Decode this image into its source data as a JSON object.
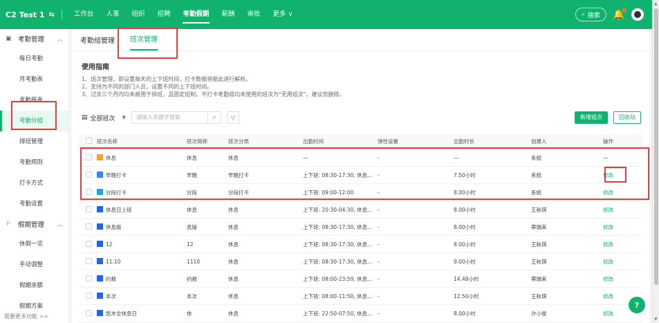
{
  "header": {
    "company": "Test 1",
    "logo_mark": "C2",
    "nav": [
      "工作台",
      "人事",
      "组织",
      "招聘",
      "考勤假期",
      "薪酬",
      "审批",
      "更多"
    ],
    "active_nav_index": 4,
    "search_label": "搜索",
    "brand_color": "#10b26e"
  },
  "sidebar": {
    "groups": [
      {
        "label": "考勤管理",
        "icon": "calendar-icon",
        "items": [
          "每日考勤",
          "月考勤表",
          "考勤报表",
          "考勤分组",
          "排班管理",
          "考勤规则",
          "打卡方式",
          "考勤设置"
        ]
      },
      {
        "label": "假期管理",
        "icon": "holiday-icon",
        "items": [
          "休假一览",
          "手动调整",
          "假期余额",
          "假期方案",
          "假期设置"
        ]
      }
    ],
    "active_item": "考勤分组",
    "footer": "我要更多功能 >>"
  },
  "tabs": [
    "考勤组管理",
    "班次管理"
  ],
  "active_tab": "班次管理",
  "guide": {
    "title": "使用指南",
    "lines": [
      "1、班次管理，即设置每天的上下班时间，打卡数据将据此进行解析。",
      "2、支持为不同的部门人员，设置不同的上下班时间。",
      "3、过去三个月内均未被用于排班，且固定班制、不打卡考勤组均未使用的班次为\"无用班次\"，建议您删除。"
    ]
  },
  "toolbar": {
    "filter_label": "全部班次",
    "search_placeholder": "请输入关键字搜索",
    "new_button": "新增班次",
    "recycle_button": "回收站"
  },
  "table": {
    "columns": [
      "班次名称",
      "班次简称",
      "班次分类",
      "出勤时间",
      "弹性设置",
      "出勤时长",
      "创建人",
      "操作"
    ],
    "rows": [
      {
        "color": "#f5a623",
        "name": "休息",
        "short": "休息",
        "type": "休息",
        "time": "—",
        "flex": "-",
        "duration": "—",
        "creator": "系统",
        "op": "—"
      },
      {
        "color": "#3b82f6",
        "name": "早晚打卡",
        "short": "早晚",
        "type": "早晚打卡",
        "time": "上下班: 08:30-17:30, 休息...",
        "flex": "-",
        "duration": "7.50小时",
        "creator": "系统",
        "op": "修改"
      },
      {
        "color": "#19a8e0",
        "name": "分段打卡",
        "short": "分段",
        "type": "分段打卡",
        "time": "上下班: 09:00-12:00",
        "flex": "-",
        "duration": "8.00小时",
        "creator": "系统",
        "op": "修改"
      },
      {
        "color": "#2563eb",
        "name": "休息日上班",
        "short": "休息",
        "type": "休息",
        "time": "上下班: 20:30-04:30, 休息...",
        "flex": "-",
        "duration": "8.00小时",
        "creator": "王秋琪",
        "op": "修改"
      },
      {
        "color": "#2563eb",
        "name": "休息版",
        "short": "息版",
        "type": "休息",
        "time": "上下班: 08:30-17:30, 休息...",
        "flex": "-",
        "duration": "8.00小时",
        "creator": "蒂瑞来",
        "op": "修改"
      },
      {
        "color": "#2563eb",
        "name": "12",
        "short": "12",
        "type": "休息",
        "time": "上下班: 08:30-17:30, 休息...",
        "flex": "-",
        "duration": "8.00小时",
        "creator": "王秋琪",
        "op": "修改"
      },
      {
        "color": "#2563eb",
        "name": "11.10",
        "short": "1110",
        "type": "休息",
        "time": "上下班: 08:30-17:30, 休息...",
        "flex": "-",
        "duration": "9.00小时",
        "creator": "王秋琪",
        "op": "修改"
      },
      {
        "color": "#2563eb",
        "name": "约救",
        "short": "约救",
        "type": "休息",
        "time": "上下班: 08:00-23:59, 休息...",
        "flex": "-",
        "duration": "14.48小时",
        "creator": "蒂瑞来",
        "op": "修改"
      },
      {
        "color": "#2563eb",
        "name": "本次",
        "short": "本次",
        "type": "休息",
        "time": "上下班: 08:00-11:50, 休息...",
        "flex": "-",
        "duration": "12.50小时",
        "creator": "王秋琪",
        "op": "修改"
      },
      {
        "color": "#2563eb",
        "name": "凯木全休息日",
        "short": "休",
        "type": "休息",
        "time": "上下班: 22:50-07:50, 休息...",
        "flex": "-",
        "duration": "8.00小时",
        "creator": "许小俊",
        "op": "修改"
      }
    ]
  }
}
